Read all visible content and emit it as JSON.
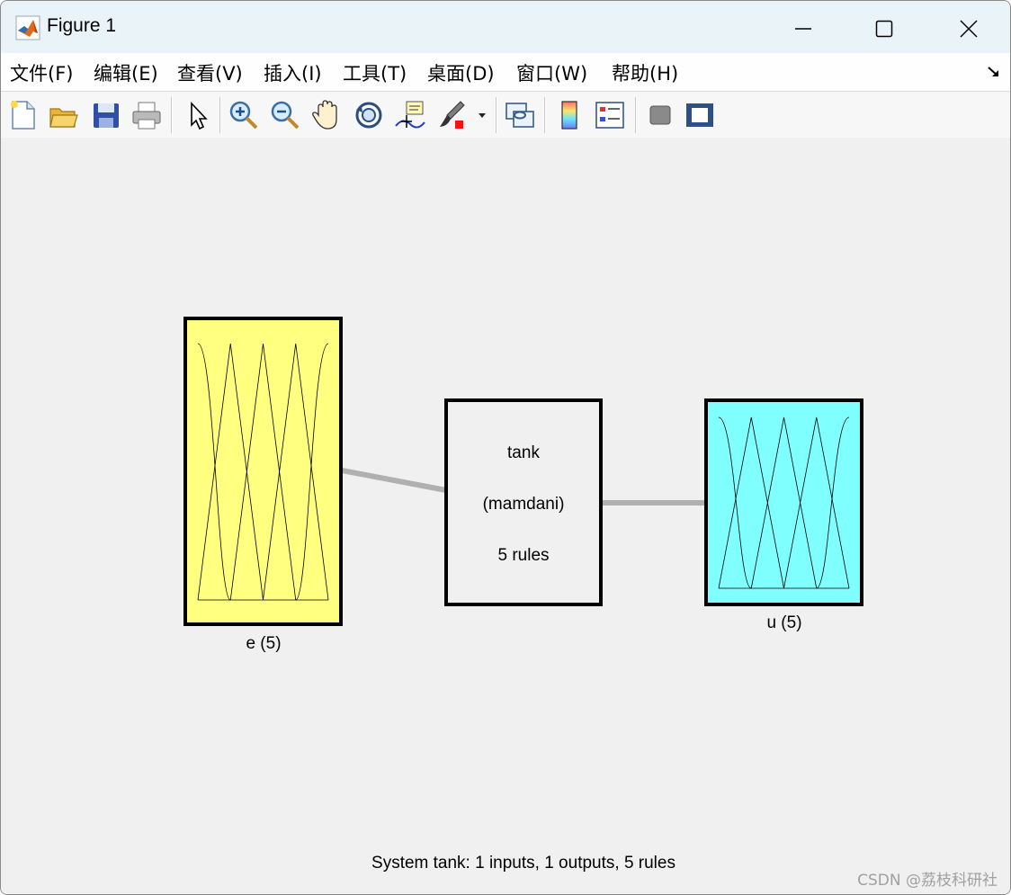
{
  "window": {
    "title": "Figure 1",
    "controls": [
      "minimize-icon",
      "maximize-icon",
      "close-icon"
    ]
  },
  "menubar": {
    "items": [
      "文件(F)",
      "编辑(E)",
      "查看(V)",
      "插入(I)",
      "工具(T)",
      "桌面(D)",
      "窗口(W)",
      "帮助(H)"
    ]
  },
  "toolbar": {
    "tools": [
      "new-figure-icon",
      "open-file-icon",
      "save-icon",
      "print-icon",
      "edit-plot-icon",
      "zoom-in-icon",
      "zoom-out-icon",
      "pan-icon",
      "rotate-3d-icon",
      "data-cursor-icon",
      "brush-icon",
      "link-plot-icon",
      "colorbar-icon",
      "legend-icon",
      "hide-plot-tools-icon",
      "show-plot-tools-icon"
    ]
  },
  "fis": {
    "input": {
      "label": "e (5)",
      "color": "#ffff80",
      "mf_count": 5
    },
    "system": {
      "name": "tank",
      "type": "(mamdani)",
      "rules": "5 rules",
      "color": "#f0f0f0"
    },
    "output": {
      "label": "u (5)",
      "color": "#80ffff",
      "mf_count": 5
    }
  },
  "status": {
    "text": "System tank: 1 inputs, 1 outputs, 5 rules"
  },
  "watermark": "CSDN @荔枝科研社",
  "colors": {
    "titlebar": "#eaf3f8",
    "canvas": "#f0f0f0",
    "connector": "#b0b0b0"
  }
}
